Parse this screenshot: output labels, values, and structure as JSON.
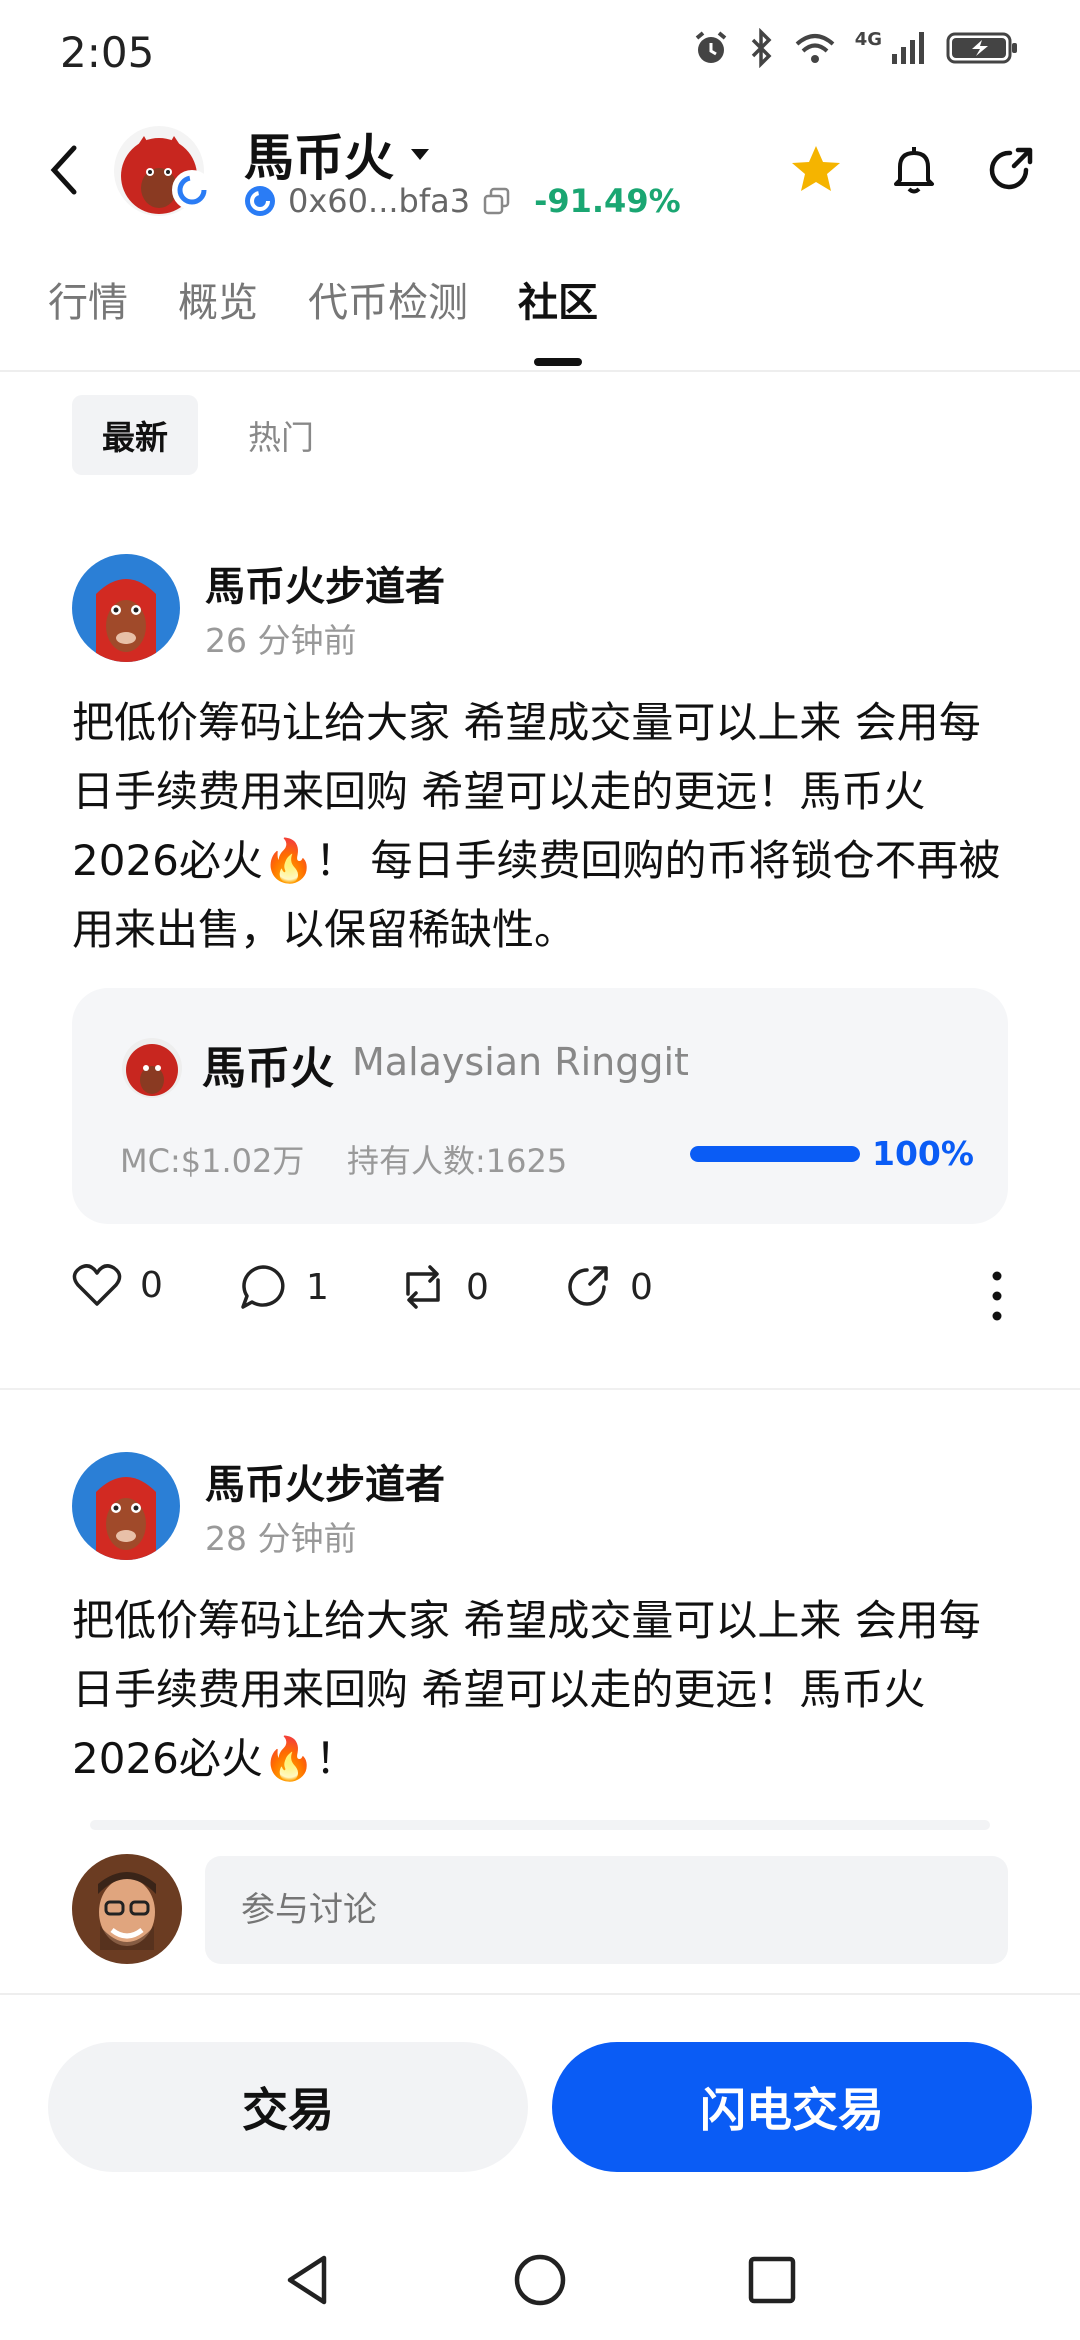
{
  "status_bar": {
    "time": "2:05",
    "network": "4G"
  },
  "header": {
    "token_name": "馬币火",
    "address": "0x60...bfa3",
    "price_change": "-91.49%",
    "colors": {
      "change": "#1aa672",
      "star": "#f5b400"
    }
  },
  "tabs": [
    {
      "label": "行情"
    },
    {
      "label": "概览"
    },
    {
      "label": "代币检测"
    },
    {
      "label": "社区"
    }
  ],
  "subtabs": [
    {
      "label": "最新"
    },
    {
      "label": "热门"
    }
  ],
  "posts": [
    {
      "author": "馬币火步道者",
      "time": "26 分钟前",
      "text": "把低价筹码让给大家 希望成交量可以上来 会用每日手续费用来回购 希望可以走的更远！馬币火2026必火🔥！ 每日手续费回购的币将锁仓不再被用来出售，以保留稀缺性。",
      "token_card": {
        "name": "馬币火",
        "full_name": "Malaysian Ringgit",
        "market_cap": "MC:$1.02万",
        "holders": "持有人数:1625",
        "progress_pct": "100%",
        "progress_fraction": 1.0
      },
      "actions": {
        "likes": "0",
        "comments": "1",
        "reposts": "0",
        "shares": "0"
      }
    },
    {
      "author": "馬币火步道者",
      "time": "28 分钟前",
      "text": "把低价筹码让给大家 希望成交量可以上来 会用每日手续费用来回购 希望可以走的更远！馬币火2026必火🔥！"
    }
  ],
  "comment": {
    "placeholder": "参与讨论"
  },
  "buttons": {
    "trade": "交易",
    "flash_trade": "闪电交易"
  },
  "colors": {
    "primary": "#0a5cf5",
    "positive": "#1aa672"
  }
}
